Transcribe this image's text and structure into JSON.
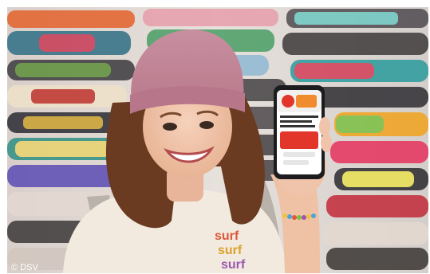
{
  "photo": {
    "credit": "© DSV",
    "shirt_lines": [
      "surf",
      "surf",
      "surf"
    ],
    "colors": {
      "beanie": "#c48a9b",
      "hair": "#6a3a21",
      "skin": "#f0c4aa",
      "shirt": "#f2eadf",
      "phone_screen_accent": "#e2362b"
    }
  }
}
